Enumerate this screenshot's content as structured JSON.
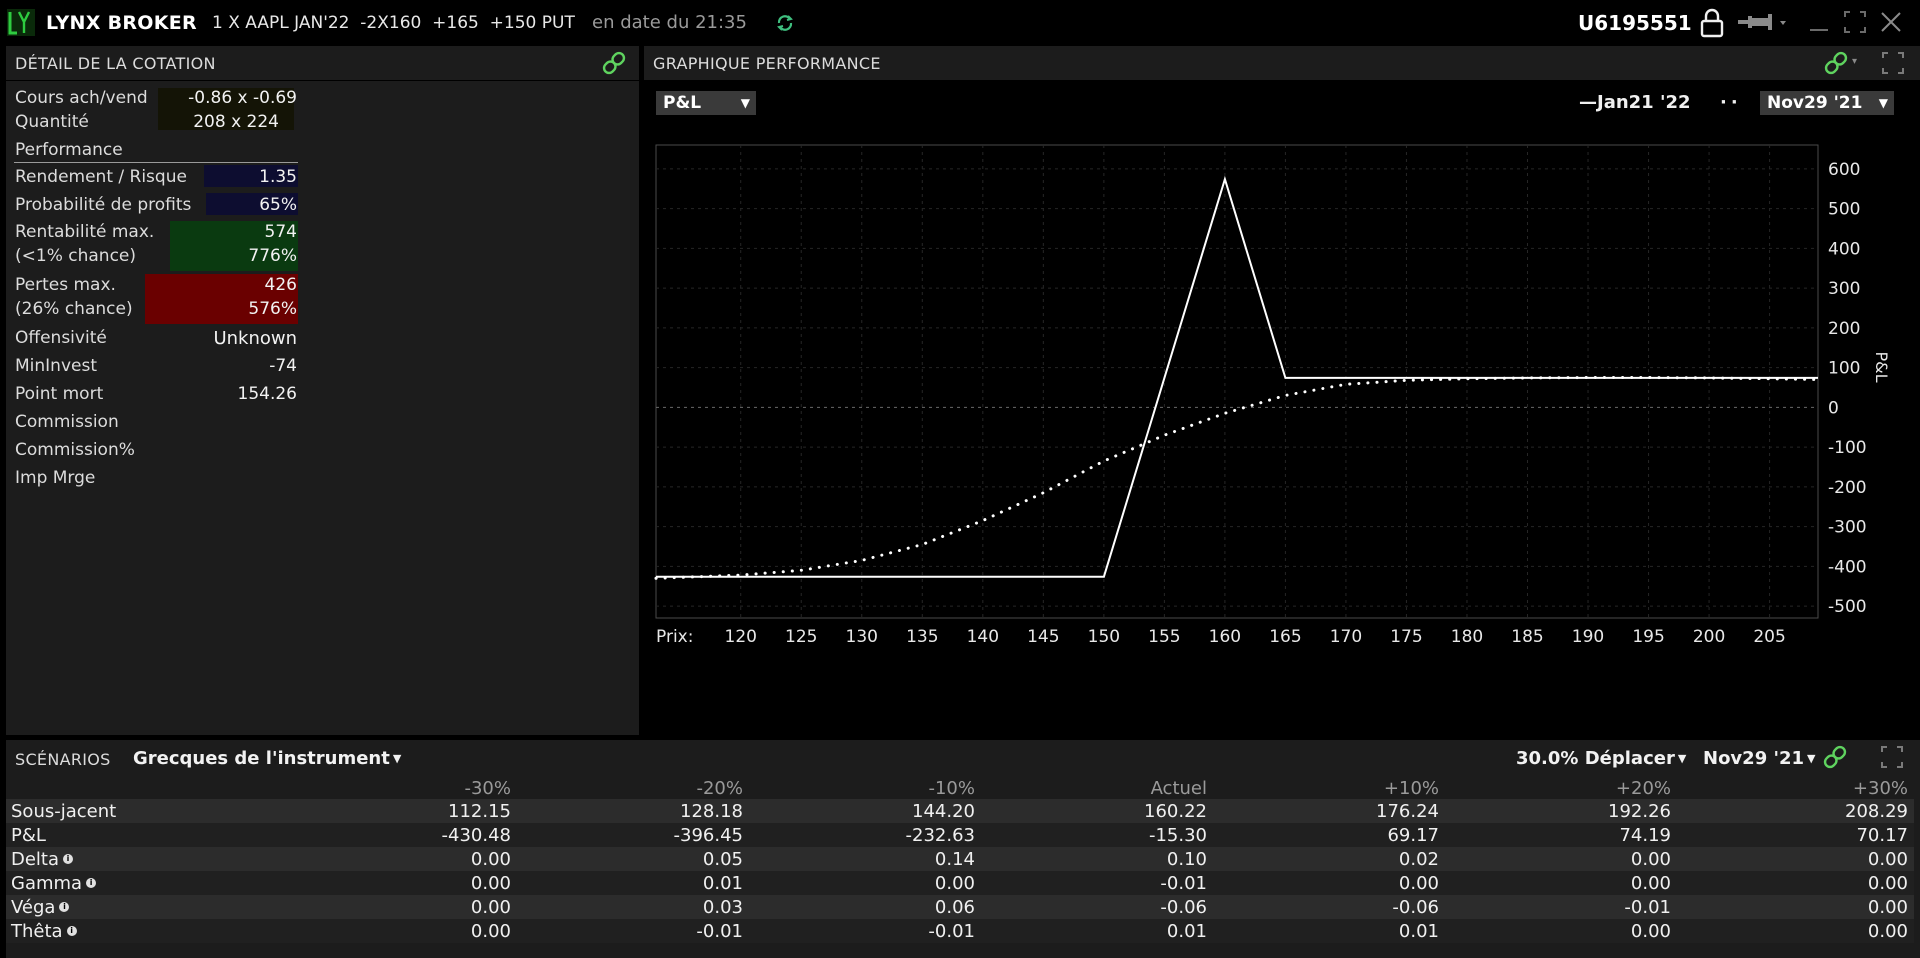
{
  "titlebar": {
    "app_name": "LYNX BROKER",
    "instrument": "1 X AAPL JAN'22  -2X160  +165  +150 PUT",
    "as_of": "en date du 21:35",
    "account": "U6195551"
  },
  "quote": {
    "title": "DÉTAIL DE LA COTATION",
    "rows": [
      {
        "label": "Cours ach/vend",
        "value": "-0.86 x -0.69"
      },
      {
        "label": "Quantité",
        "value": "208 x 224"
      }
    ],
    "performance_header": "Performance",
    "perf_rows": [
      {
        "label": "Rendement / Risque",
        "value": "1.35"
      },
      {
        "label": "Probabilité de profits",
        "value": "65%"
      },
      {
        "label": "Rentabilité max.",
        "value": "574",
        "sublabel": "(<1% chance)",
        "subvalue": "776%"
      },
      {
        "label": "Pertes max.",
        "value": "426",
        "sublabel": "(26% chance)",
        "subvalue": "576%"
      },
      {
        "label": "Offensivité",
        "value": "Unknown"
      },
      {
        "label": "MinInvest",
        "value": "-74"
      },
      {
        "label": "Point mort",
        "value": "154.26"
      },
      {
        "label": "Commission",
        "value": ""
      },
      {
        "label": "Commission%",
        "value": ""
      },
      {
        "label": "Imp Mrge",
        "value": ""
      }
    ],
    "colors": {
      "blue_box": "#0d0d30",
      "green_box": "#0a3a10",
      "red_box": "#6a0000"
    }
  },
  "chart": {
    "title": "GRAPHIQUE PERFORMANCE",
    "metric_select": "P&L",
    "legend_solid": "Jan21 '22",
    "date_select": "Nov29 '21",
    "x_prefix": "Prix:",
    "ylabel": "P&L"
  },
  "chart_data": {
    "type": "line",
    "xlabel": "Prix:",
    "ylabel": "P&L",
    "xlim": [
      113,
      209
    ],
    "ylim": [
      -530,
      660
    ],
    "x_ticks": [
      120,
      125,
      130,
      135,
      140,
      145,
      150,
      155,
      160,
      165,
      170,
      175,
      180,
      185,
      190,
      195,
      200,
      205
    ],
    "y_ticks": [
      600,
      500,
      400,
      300,
      200,
      100,
      0,
      -100,
      -200,
      -300,
      -400,
      -500
    ],
    "grid": true,
    "legend_position": "top-right",
    "series": [
      {
        "name": "Jan21 '22",
        "style": "solid",
        "x": [
          113,
          150,
          160,
          165,
          209
        ],
        "y": [
          -426,
          -426,
          574,
          74,
          74
        ]
      },
      {
        "name": "Nov29 '21",
        "style": "dotted",
        "x": [
          113,
          120,
          125,
          130,
          135,
          140,
          145,
          150,
          155,
          160,
          165,
          170,
          175,
          180,
          185,
          190,
          195,
          200,
          205,
          209
        ],
        "y": [
          -430,
          -422,
          -410,
          -385,
          -345,
          -285,
          -215,
          -135,
          -70,
          -15,
          30,
          58,
          68,
          72,
          74,
          75,
          75,
          74,
          72,
          70
        ]
      }
    ]
  },
  "scenarios": {
    "title": "SCÉNARIOS",
    "dropdown": "Grecques de l'instrument",
    "shift": "30.0% Déplacer",
    "date": "Nov29 '21",
    "columns": [
      "",
      "-30%",
      "-20%",
      "-10%",
      "Actuel",
      "+10%",
      "+20%",
      "+30%"
    ],
    "rows": [
      {
        "label": "Sous-jacent",
        "info": false,
        "values": [
          "112.15",
          "128.18",
          "144.20",
          "160.22",
          "176.24",
          "192.26",
          "208.29"
        ]
      },
      {
        "label": "P&L",
        "info": false,
        "values": [
          "-430.48",
          "-396.45",
          "-232.63",
          "-15.30",
          "69.17",
          "74.19",
          "70.17"
        ]
      },
      {
        "label": "Delta",
        "info": true,
        "values": [
          "0.00",
          "0.05",
          "0.14",
          "0.10",
          "0.02",
          "0.00",
          "0.00"
        ]
      },
      {
        "label": "Gamma",
        "info": true,
        "values": [
          "0.00",
          "0.01",
          "0.00",
          "-0.01",
          "0.00",
          "0.00",
          "0.00"
        ]
      },
      {
        "label": "Véga",
        "info": true,
        "values": [
          "0.00",
          "0.03",
          "0.06",
          "-0.06",
          "-0.06",
          "-0.01",
          "0.00"
        ]
      },
      {
        "label": "Thêta",
        "info": true,
        "values": [
          "0.00",
          "-0.01",
          "-0.01",
          "0.01",
          "0.01",
          "0.00",
          "0.00"
        ]
      }
    ]
  }
}
